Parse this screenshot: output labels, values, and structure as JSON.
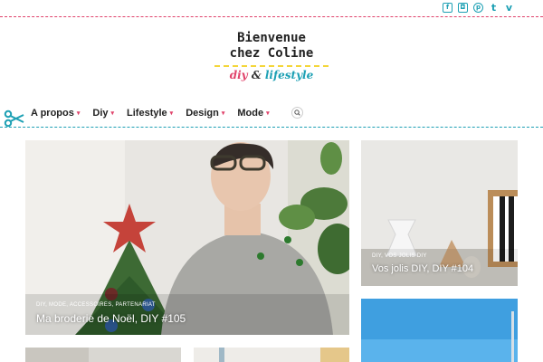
{
  "social": {
    "icons": [
      "facebook-icon",
      "instagram-icon",
      "pinterest-icon",
      "tumblr-icon",
      "vimeo-icon"
    ],
    "glyphs": [
      "f",
      "◘",
      "p",
      "t",
      "v"
    ],
    "color": "#1da0b4"
  },
  "logo": {
    "line1": "Bienvenue",
    "line2": "chez Coline",
    "diy": "diy",
    "amp": "&",
    "lifestyle": "lifestyle"
  },
  "nav": {
    "items": [
      {
        "label": "A propos"
      },
      {
        "label": "Diy"
      },
      {
        "label": "Lifestyle"
      },
      {
        "label": "Design"
      },
      {
        "label": "Mode"
      }
    ],
    "caret": "▾"
  },
  "posts": [
    {
      "categories": "DIY, MODE, ACCESSOIRES, PARTENARIAT",
      "title": "Ma broderie de Noël, DIY #105"
    },
    {
      "categories": "DIY, VOS JOLIS DIY",
      "title": "Vos jolis DIY, DIY #104"
    }
  ],
  "colors": {
    "accent_pink": "#e0436b",
    "accent_blue": "#1da0b4",
    "accent_yellow": "#f4d63a"
  }
}
